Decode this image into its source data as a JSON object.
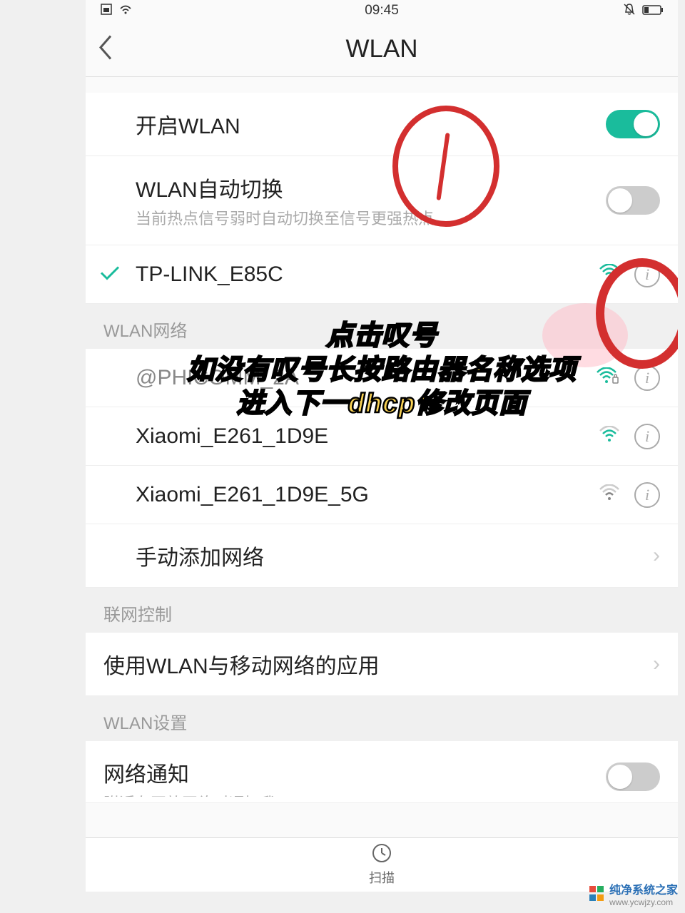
{
  "status": {
    "time": "09:45"
  },
  "header": {
    "title": "WLAN"
  },
  "settings": {
    "wlan_enable": {
      "label": "开启WLAN",
      "on": true
    },
    "auto_switch": {
      "label": "WLAN自动切换",
      "subtitle": "当前热点信号弱时自动切换至信号更强热点",
      "on": false
    }
  },
  "connected_network": {
    "name": "TP-LINK_E85C"
  },
  "sections": {
    "networks_header": "WLAN网络",
    "control_header": "联网控制",
    "settings_header": "WLAN设置"
  },
  "networks": [
    {
      "name": "@PHICOMM_2A",
      "locked": true,
      "signal": "strong"
    },
    {
      "name": "Xiaomi_E261_1D9E",
      "locked": false,
      "signal": "medium"
    },
    {
      "name": "Xiaomi_E261_1D9E_5G",
      "locked": false,
      "signal": "weak"
    }
  ],
  "manual_add": {
    "label": "手动添加网络"
  },
  "control": {
    "app_usage": "使用WLAN与移动网络的应用"
  },
  "wlan_settings": {
    "network_notify": {
      "label": "网络通知",
      "subtitle": "附近有开放网络时通知我",
      "on": false
    }
  },
  "footer": {
    "scan": "扫描"
  },
  "annotations": {
    "line1": "点击叹号",
    "line2": "如没有叹号长按路由器名称选项",
    "line3": "进入下一dhcp修改页面"
  },
  "watermark": {
    "name": "纯净系统之家",
    "url": "www.ycwjzy.com"
  }
}
